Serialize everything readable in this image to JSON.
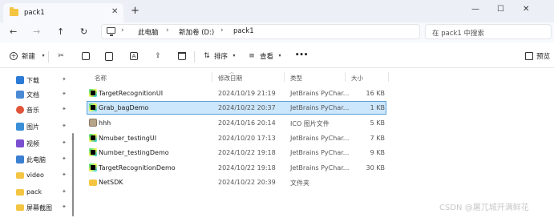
{
  "window": {
    "tab_title": "pack1",
    "tab_close": "✕",
    "new_tab": "+",
    "minimize": "—",
    "maximize": "☐",
    "close": "✕"
  },
  "nav": {
    "back": "←",
    "forward": "→",
    "up": "↑",
    "refresh": "↻"
  },
  "address": {
    "crumbs": [
      "此电脑",
      "新加卷 (D:)",
      "pack1"
    ],
    "separator": "›"
  },
  "search": {
    "placeholder": "在 pack1 中搜索"
  },
  "toolbar": {
    "new_label": "新建",
    "sort_label": "排序",
    "view_label": "查看",
    "more_label": "•••",
    "preview_label": "预览"
  },
  "sidebar": {
    "items": [
      {
        "label": "下载",
        "icon": "download-icon",
        "color": "#2b7bd6",
        "pinned": true
      },
      {
        "label": "文档",
        "icon": "documents-icon",
        "color": "#4a8ad4",
        "pinned": true
      },
      {
        "label": "音乐",
        "icon": "music-icon",
        "color": "#e0543a",
        "pinned": true
      },
      {
        "label": "图片",
        "icon": "pictures-icon",
        "color": "#3a8fd8",
        "pinned": true
      },
      {
        "label": "视频",
        "icon": "videos-icon",
        "color": "#7b4fd1",
        "pinned": true
      },
      {
        "label": "此电脑",
        "icon": "computer-icon",
        "color": "#3a7fd0",
        "pinned": true
      },
      {
        "label": "video",
        "icon": "folder-icon",
        "color": "#f4c542",
        "pinned": true
      },
      {
        "label": "pack",
        "icon": "folder-icon",
        "color": "#f4c542",
        "pinned": true
      },
      {
        "label": "屏幕截图",
        "icon": "folder-icon",
        "color": "#f4c542",
        "pinned": true
      }
    ],
    "pin_glyph": "✦"
  },
  "columns": {
    "name": "名称",
    "modified": "修改日期",
    "type": "类型",
    "size": "大小"
  },
  "files": [
    {
      "name": "TargetRecognitionUI",
      "modified": "2024/10/19 21:19",
      "type": "JetBrains PyChar...",
      "size": "16 KB",
      "icon": "pycharm-file-icon",
      "selected": false
    },
    {
      "name": "Grab_bagDemo",
      "modified": "2024/10/22 20:37",
      "type": "JetBrains PyChar...",
      "size": "1 KB",
      "icon": "pycharm-file-icon",
      "selected": true
    },
    {
      "name": "hhh",
      "modified": "2024/10/16 20:14",
      "type": "ICO 图片文件",
      "size": "5 KB",
      "icon": "image-file-icon",
      "selected": false
    },
    {
      "name": "Nmuber_testingUI",
      "modified": "2024/10/20 17:13",
      "type": "JetBrains PyChar...",
      "size": "7 KB",
      "icon": "pycharm-file-icon",
      "selected": false
    },
    {
      "name": "Number_testingDemo",
      "modified": "2024/10/22 19:18",
      "type": "JetBrains PyChar...",
      "size": "9 KB",
      "icon": "pycharm-file-icon",
      "selected": false
    },
    {
      "name": "TargetRecognitionDemo",
      "modified": "2024/10/22 19:18",
      "type": "JetBrains PyChar...",
      "size": "30 KB",
      "icon": "pycharm-file-icon",
      "selected": false
    },
    {
      "name": "NetSDK",
      "modified": "2024/10/22 20:39",
      "type": "文件夹",
      "size": "",
      "icon": "folder-icon",
      "selected": false
    }
  ],
  "watermark": "CSDN @屠兀城开满鲜花"
}
